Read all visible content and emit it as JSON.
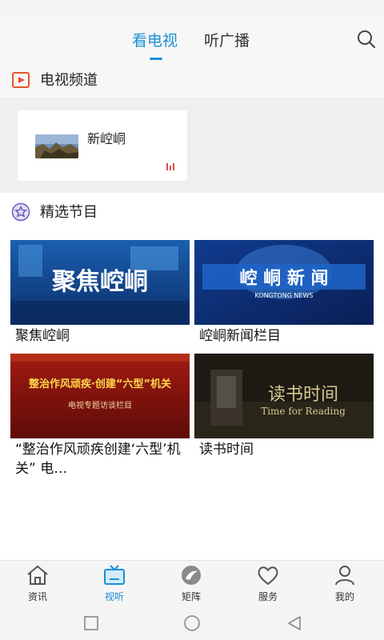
{
  "header": {
    "tabs": [
      {
        "label": "看电视",
        "active": true
      },
      {
        "label": "听广播",
        "active": false
      }
    ],
    "search_icon": "search-icon"
  },
  "channels_section": {
    "title": "电视频道",
    "icon": "play-icon",
    "items": [
      {
        "name": "新崆峒"
      }
    ]
  },
  "picks_section": {
    "title": "精选节目",
    "icon": "star-badge-icon",
    "programs": [
      {
        "title": "聚焦崆峒",
        "thumb_text": "聚焦崆峒"
      },
      {
        "title": "崆峒新闻栏目",
        "thumb_text": "崆 峒 新 闻",
        "thumb_subtext": "KONGTONG NEWS"
      },
      {
        "title": "“整治作风顽疾创建‘六型’机关” 电…",
        "thumb_text": "整治作风顽疾·创建“六型”机关",
        "thumb_subtext": "电视专题访谈栏目"
      },
      {
        "title": "读书时间",
        "thumb_text": "读书时间",
        "thumb_subtext": "Time for Reading"
      }
    ]
  },
  "bottom_nav": [
    {
      "label": "资讯",
      "icon": "home-icon",
      "active": false
    },
    {
      "label": "视听",
      "icon": "tv-icon",
      "active": true
    },
    {
      "label": "矩阵",
      "icon": "matrix-logo-icon",
      "active": false
    },
    {
      "label": "服务",
      "icon": "heart-icon",
      "active": false
    },
    {
      "label": "我的",
      "icon": "user-icon",
      "active": false
    }
  ],
  "colors": {
    "accent": "#1a8fd6",
    "channel_icon": "#e3562a",
    "star_icon": "#6a5bbf"
  }
}
